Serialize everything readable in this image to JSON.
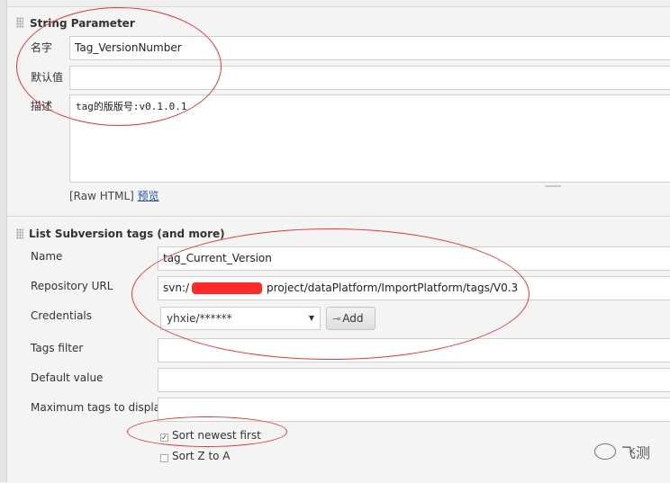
{
  "string_parameter": {
    "title": "String Parameter",
    "name_label": "名字",
    "name_value": "Tag_VersionNumber",
    "default_label": "默认值",
    "default_value": "",
    "desc_label": "描述",
    "desc_value": "tag的版版号:v0.1.0.1",
    "raw_html_text": "[Raw HTML]",
    "preview_link": "预览"
  },
  "list_svn_tags": {
    "title": "List Subversion tags (and more)",
    "name_label": "Name",
    "name_value": "tag_Current_Version",
    "repo_label": "Repository URL",
    "repo_prefix": "svn:/",
    "repo_suffix": "project/dataPlatform/ImportPlatform/tags/V0.3",
    "credentials_label": "Credentials",
    "credentials_value": "yhxie/******",
    "add_button": "Add",
    "tags_filter_label": "Tags filter",
    "tags_filter_value": "",
    "default_value_label": "Default value",
    "default_value_value": "",
    "max_tags_label": "Maximum tags to display",
    "max_tags_value": "",
    "sort_newest_label": "Sort newest first",
    "sort_newest_checked": true,
    "sort_z_to_a_label": "Sort Z to A",
    "sort_z_to_a_checked": false
  },
  "watermark": {
    "text": "飞测"
  },
  "colors": {
    "annotation": "#e23a3a",
    "redaction": "#ff2a2a",
    "link": "#2255aa"
  }
}
